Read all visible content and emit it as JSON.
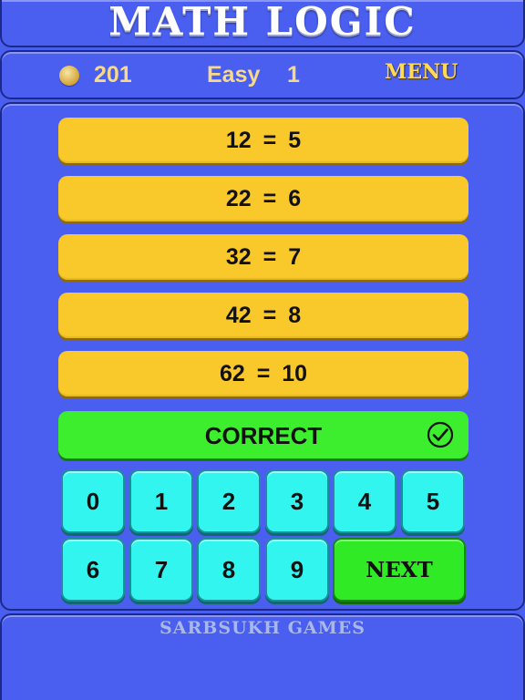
{
  "header": {
    "title": "MATH LOGIC"
  },
  "status": {
    "coins": "201",
    "level_name": "Easy",
    "level_number": "1",
    "menu_label": "MENU"
  },
  "equations": [
    "12 = 5",
    "22 = 6",
    "32 = 7",
    "42 = 8",
    "62 = 10"
  ],
  "answer": {
    "text": "CORRECT",
    "icon": "check-circle-icon",
    "color": "#3dee2f"
  },
  "keypad": {
    "row1": [
      "0",
      "1",
      "2",
      "3",
      "4",
      "5"
    ],
    "row2": [
      "6",
      "7",
      "8",
      "9"
    ],
    "next_label": "NEXT"
  },
  "footer": {
    "brand": "SARBSUKH GAMES"
  },
  "colors": {
    "background": "#4a5ff0",
    "equation_bg": "#f9c82a",
    "key_bg": "#33f5ef",
    "next_bg": "#2fea24",
    "menu_text": "#ffd95a"
  }
}
